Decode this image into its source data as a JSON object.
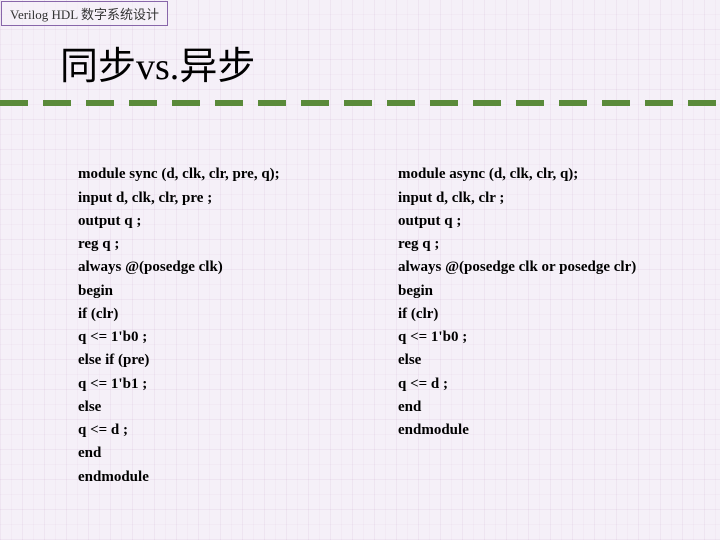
{
  "header": {
    "tab_label": "Verilog HDL 数字系统设计"
  },
  "title": {
    "text_before_vs": "同步",
    "vs": "vs.",
    "text_after_vs": "异步"
  },
  "code": {
    "sync": {
      "line1": "module sync (d, clk, clr, pre, q);",
      "line2": "input d, clk, clr, pre ;",
      "line3": "output q ;",
      "line4": "reg q ;",
      "line5": "always @(posedge clk)",
      "line6": "begin",
      "line7": "if (clr)",
      "line8": "q <= 1'b0 ;",
      "line9": "else if (pre)",
      "line10": "q <= 1'b1 ;",
      "line11": "else",
      "line12": "q <= d ;",
      "line13": "end",
      "line14": "endmodule"
    },
    "async": {
      "line1": "module async (d, clk, clr, q);",
      "line2": "input d, clk, clr ;",
      "line3": "output q ;",
      "line4": "reg q ;",
      "line5": "always @(posedge clk or posedge clr)",
      "line6": "begin",
      "line7": "if (clr)",
      "line8": "q <= 1'b0 ;",
      "line9": "else",
      "line10": "q <= d ;",
      "line11": "end",
      "line12": "endmodule"
    }
  }
}
